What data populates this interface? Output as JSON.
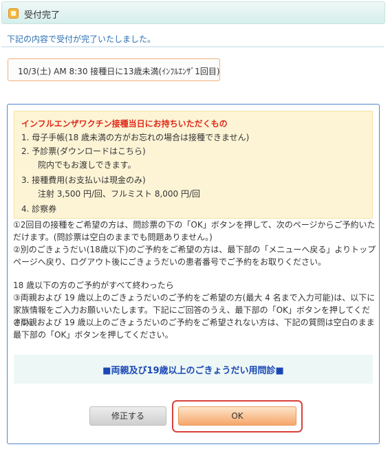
{
  "header": {
    "title": "受付完了",
    "icon": "package-icon"
  },
  "intro": "下記の内容で受付が完了いたしました。",
  "summary": "10/3(土) AM 8:30 接種日に13歳未満(ｲﾝﾌﾙｴﾝｻﾞ1回目)",
  "notice": {
    "title": "インフルエンザワクチン接種当日にお持ちいただくもの",
    "items": [
      "1. 母子手帳(18 歳未満の方がお忘れの場合は接種できません)",
      "2. 予診票(ダウンロードはこちら)",
      "院内でもお渡しできます。",
      "3. 接種費用(お支払いは現金のみ)",
      "注射 3,500 円/回、フルミスト 8,000 円/回",
      "4. 診察券"
    ]
  },
  "paragraphs": [
    "①2回目の接種をご希望の方は、問診票の下の「OK」ボタンを押して、次のページからご予約いただけます。(問診票は空白のままでも問題ありません。)",
    "②別のごきょうだい(18歳以下)のご予約をご希望の方は、最下部の「メニューへ戻る」よりトップページへ戻り、ログアウト後にごきょうだいの患者番号でご予約をお取りください。",
    "18 歳以下の方のご予約がすべて終わったら",
    "③両親および 19 歳以上のごきょうだいのご予約をご希望の方(最大 4 名まで入力可能)は、以下に家族情報をご入力お願いいたします。下記にご回答のうえ、最下部の「OK」ボタンを押してください。",
    "④両親および 19 歳以上のごきょうだいのご予約をご希望されない方は、下記の質問は空白のまま最下部の「OK」ボタンを押してください。"
  ],
  "question_title": "■両親及び19歳以上のごきょうだい用問診■",
  "buttons": {
    "edit": "修正する",
    "ok": "OK"
  },
  "colors": {
    "notice_title": "#e02a1a",
    "question_title": "#1a47b5",
    "ok_highlight": "#d9403a"
  }
}
